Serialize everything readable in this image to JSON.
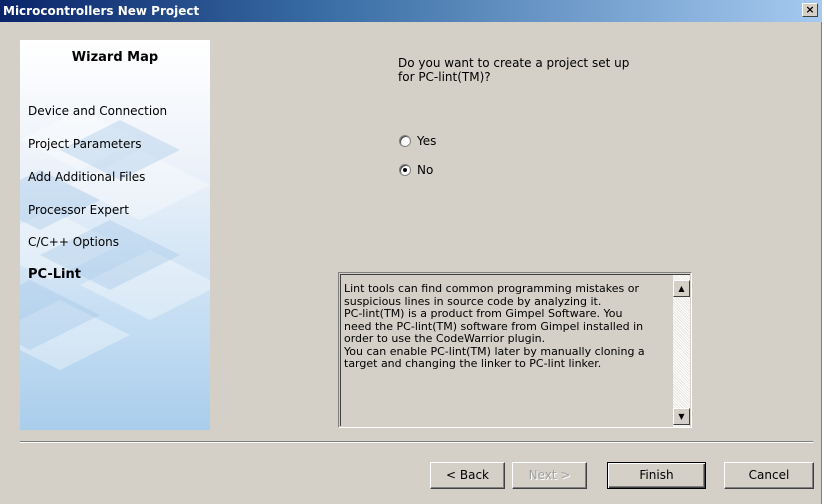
{
  "window": {
    "title": "Microcontrollers New Project",
    "close_label": "×"
  },
  "wizard_map": {
    "title": "Wizard Map",
    "items": [
      {
        "label": "Device and Connection"
      },
      {
        "label": "Project Parameters"
      },
      {
        "label": "Add Additional Files"
      },
      {
        "label": "Processor Expert"
      },
      {
        "label": "C/C++ Options"
      },
      {
        "label": "PC-Lint",
        "active": true
      }
    ]
  },
  "question": "Do you want to create a project set up\nfor PC-lint(TM)?",
  "options": [
    {
      "label": "Yes",
      "selected": false
    },
    {
      "label": "No",
      "selected": true
    }
  ],
  "description": "Lint tools can find common programming mistakes or\nsuspicious lines in source code by analyzing it.\nPC-lint(TM) is a product from Gimpel Software. You\nneed the PC-lint(TM) software from Gimpel installed in\norder to use the CodeWarrior plugin.\nYou can enable PC-lint(TM) later by manually cloning a\ntarget and changing the linker to PC-lint linker.",
  "scroll_icons": {
    "up": "▲",
    "down": "▼"
  },
  "buttons": {
    "back": "< Back",
    "next": "Next >",
    "finish": "Finish",
    "cancel": "Cancel"
  }
}
